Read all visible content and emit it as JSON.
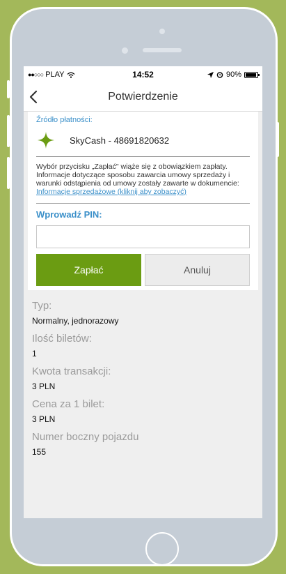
{
  "status_bar": {
    "carrier": "PLAY",
    "time": "14:52",
    "battery": "90%"
  },
  "nav": {
    "title": "Potwierdzenie",
    "back_icon": "chevron-left-icon"
  },
  "payment": {
    "source_label": "Źródło płatności:",
    "source_value": "SkyCash - 48691820632",
    "info_text": "Wybór przycisku „Zapłać\" wiąże się z obowiązkiem zapłaty. Informacje dotyczące sposobu zawarcia umowy sprzedaży i warunki odstąpienia od umowy zostały zawarte w dokumencie:",
    "info_link": "Informacje sprzedażowe (kliknij aby zobaczyć)",
    "pin_label": "Wprowadź PIN:",
    "pin_value": "",
    "pay_label": "Zapłać",
    "cancel_label": "Anuluj"
  },
  "details": [
    {
      "label": "Typ:",
      "value": "Normalny, jednorazowy"
    },
    {
      "label": "Ilość biletów:",
      "value": "1"
    },
    {
      "label": "Kwota transakcji:",
      "value": "3 PLN"
    },
    {
      "label": "Cena za 1 bilet:",
      "value": "3 PLN"
    },
    {
      "label": "Numer boczny pojazdu",
      "value": "155"
    }
  ],
  "colors": {
    "accent_blue": "#3a8fc9",
    "pay_green": "#6b9c12",
    "background_green": "#a3b85a"
  }
}
